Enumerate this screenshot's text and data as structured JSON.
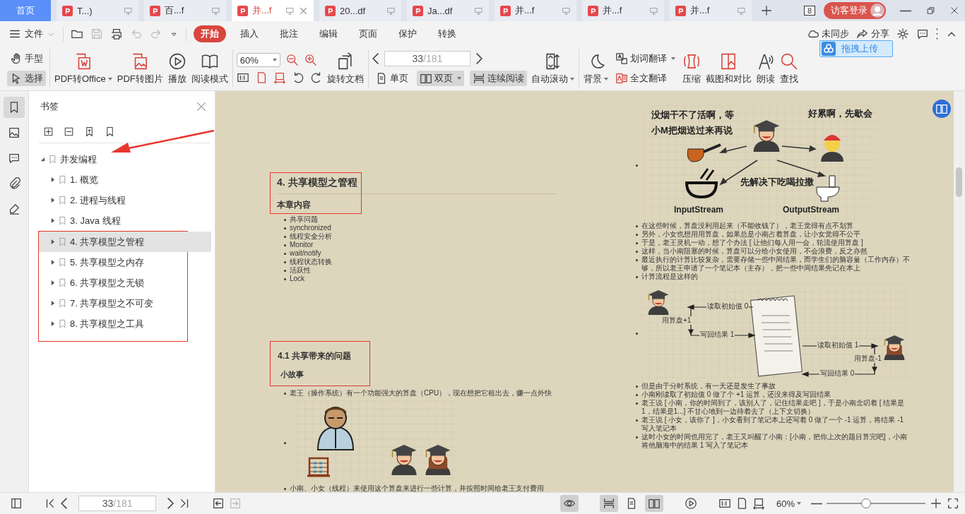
{
  "tabs": [
    {
      "label": "首页",
      "kind": "home",
      "selected": false
    },
    {
      "label": "T...)",
      "kind": "pdf",
      "selected": false
    },
    {
      "label": "百...f",
      "kind": "pdf",
      "selected": false
    },
    {
      "label": "并...f",
      "kind": "pdf",
      "selected": true
    },
    {
      "label": "20...df",
      "kind": "pdf",
      "selected": false
    },
    {
      "label": "Ja...df",
      "kind": "pdf",
      "selected": false
    },
    {
      "label": "并...f",
      "kind": "pdf",
      "selected": false
    },
    {
      "label": "并...f",
      "kind": "pdf",
      "selected": false
    },
    {
      "label": "并...f",
      "kind": "pdf",
      "selected": false
    }
  ],
  "window_count": "8",
  "login_button": "访客登录",
  "menu": {
    "file": "文件",
    "tabs": [
      {
        "label": "开始",
        "selected": true
      },
      {
        "label": "插入",
        "selected": false
      },
      {
        "label": "批注",
        "selected": false
      },
      {
        "label": "编辑",
        "selected": false
      },
      {
        "label": "页面",
        "selected": false
      },
      {
        "label": "保护",
        "selected": false
      },
      {
        "label": "转换",
        "selected": false
      }
    ],
    "sync": "未同步",
    "share": "分享",
    "upload": "拖拽上传"
  },
  "ribbon": {
    "pointer_tools": [
      {
        "label": "手型",
        "selected": false
      },
      {
        "label": "选择",
        "selected": true
      }
    ],
    "convert_buttons": [
      {
        "label": "PDF转Office",
        "dropdown": true
      },
      {
        "label": "PDF转图片",
        "dropdown": false
      },
      {
        "label": "播放",
        "dropdown": false
      },
      {
        "label": "阅读模式",
        "dropdown": false
      }
    ],
    "zoom_select": "60%",
    "rotate_button": "旋转文档",
    "page_input": {
      "value": "33",
      "total": "/181"
    },
    "layout_buttons": [
      {
        "label": "单页",
        "selected": false,
        "dropdown": false
      },
      {
        "label": "双页",
        "selected": true,
        "dropdown": true
      },
      {
        "label": "连续阅读",
        "selected": true,
        "dropdown": false
      }
    ],
    "auto_scroll": {
      "label": "自动滚动",
      "dropdown": true
    },
    "background": {
      "label": "背景",
      "dropdown": true
    },
    "translate_buttons": [
      {
        "label": "划词翻译",
        "dropdown": true
      },
      {
        "label": "全文翻译",
        "dropdown": false
      }
    ],
    "tool_buttons": [
      "压缩",
      "截图和对比",
      "朗读",
      "查找"
    ]
  },
  "side_strip": [
    {
      "selected": true
    },
    {
      "selected": false
    },
    {
      "selected": false
    },
    {
      "selected": false
    },
    {
      "selected": false
    }
  ],
  "bookmarks": {
    "title": "书签",
    "tree": [
      {
        "label": "并发编程",
        "expanded": true,
        "selected": false,
        "children": [
          {
            "label": "1. 概览",
            "expanded": false,
            "selected": false
          },
          {
            "label": "2. 进程与线程",
            "expanded": false,
            "selected": false
          },
          {
            "label": "3. Java 线程",
            "expanded": false,
            "selected": false
          },
          {
            "label": "4. 共享模型之管程",
            "expanded": false,
            "selected": true
          },
          {
            "label": "5. 共享模型之内存",
            "expanded": false,
            "selected": false
          },
          {
            "label": "6. 共享模型之无锁",
            "expanded": false,
            "selected": false
          },
          {
            "label": "7. 共享模型之不可变",
            "expanded": false,
            "selected": false
          },
          {
            "label": "8. 共享模型之工具",
            "expanded": false,
            "selected": false
          }
        ]
      }
    ]
  },
  "left_page": {
    "heading": "4. 共享模型之管程",
    "subheading": "本章内容",
    "contents": [
      "共享问题",
      "synchronized",
      "线程安全分析",
      "Monitor",
      "wait/notify",
      "线程状态转换",
      "活跃性",
      "Lock"
    ],
    "section_heading": "4.1 共享带来的问题",
    "section_subheading": "小故事",
    "story_before": "老王（操作系统）有一个功能强大的算盘（CPU），现在想把它租出去，赚一点外快",
    "story_after": "小南、小女（线程）来使用这个算盘来进行一些计算，并按照时间给老王支付费用"
  },
  "right_page": {
    "figure_labels": {
      "thought": [
        "没烟干不了活啊，等",
        "小M把烟送过来再说"
      ],
      "tired": "好累啊，先歇会",
      "needs": "先解决下吃喝拉撒",
      "input": "InputStream",
      "output": "OutputStream"
    },
    "items_before": [
      "在这些时候，算盘没利用起来（不能收钱了），老王觉得有点不划算",
      "另外，小女也想用用算盘，如果总是小南占着算盘，让小女觉得不公平",
      "于是，老王灵机一动，想了个办法 [ 让他们每人用一会，轮流使用算盘 ]",
      "这样，当小南阻塞的时候，算盘可以分给小女使用，不会浪费，反之亦然",
      "最近执行的计算比较复杂，需要存储一些中间结果，而学生们的脑容量（工作内存）不够，所以老王申请了一个笔记本（主存），把一些中间结果先记在本上",
      "计算流程是这样的"
    ],
    "diagram_labels": [
      "读取初始值 0",
      "用算盘+1",
      "写回结果 1",
      "读取初始值 1",
      "用算盘-1",
      "写回结果 0"
    ],
    "items_after": [
      "但是由于分时系统，有一天还是发生了事故",
      "小南刚读取了初始值 0 做了个 +1 运算，还没来得及写回结果",
      "老王说 [ 小南，你的时间到了，该别人了，记住结果走吧 ]，于是小南念叨着 [ 结果是1，结果是1...] 不甘心地到一边待着去了（上下文切换）",
      "老王说 [ 小女，该你了 ]，小女看到了笔记本上还写着 0 做了一个 -1 运算，将结果 -1 写入笔记本",
      "这时小女的时间也用完了，老王又叫醒了小南：[小南，把你上次的题目算完吧]，小南将他脑海中的结果 1 写入了笔记本"
    ]
  },
  "status_bar": {
    "page_input": {
      "value": "33",
      "total": "/181"
    },
    "view_buttons": [
      {
        "selected": true
      },
      {
        "selected": true
      },
      {
        "selected": false
      },
      {
        "selected": true
      }
    ],
    "zoom": "60%",
    "zoom_slider": {
      "level": 0.4
    }
  }
}
